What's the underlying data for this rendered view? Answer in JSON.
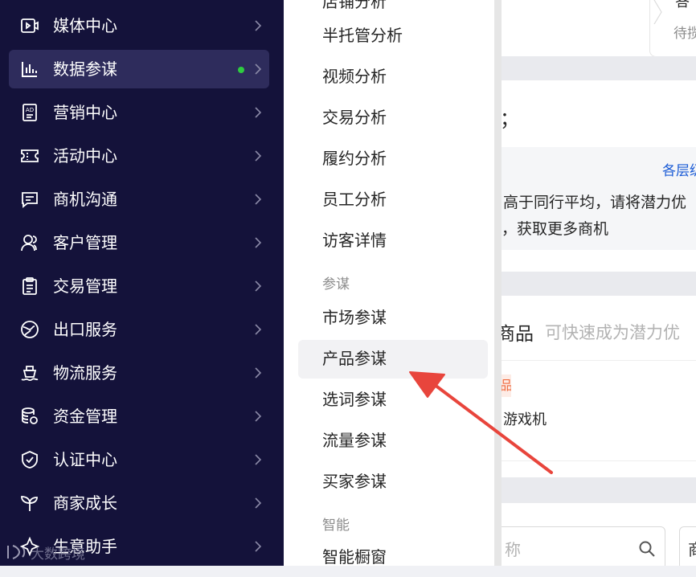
{
  "sidebar": {
    "items": [
      {
        "label": "媒体中心",
        "icon": "media-icon"
      },
      {
        "label": "数据参谋",
        "icon": "bar-chart-icon"
      },
      {
        "label": "营销中心",
        "icon": "ad-icon"
      },
      {
        "label": "活动中心",
        "icon": "ticket-icon"
      },
      {
        "label": "商机沟通",
        "icon": "chat-icon"
      },
      {
        "label": "客户管理",
        "icon": "users-icon"
      },
      {
        "label": "交易管理",
        "icon": "clipboard-icon"
      },
      {
        "label": "出口服务",
        "icon": "globe-icon"
      },
      {
        "label": "物流服务",
        "icon": "shipping-icon"
      },
      {
        "label": "资金管理",
        "icon": "coins-icon"
      },
      {
        "label": "认证中心",
        "icon": "shield-check-icon"
      },
      {
        "label": "商家成长",
        "icon": "sprout-icon"
      },
      {
        "label": "生意助手",
        "icon": "sparkle-icon"
      }
    ],
    "active_index": 1,
    "active_dot_color": "#2ecc40",
    "background_color": "#14123a"
  },
  "watermark": {
    "text": "大数跨境"
  },
  "submenu": {
    "top_partial_label": "店铺分析",
    "items": [
      {
        "label": "半托管分析"
      },
      {
        "label": "视频分析"
      },
      {
        "label": "交易分析"
      },
      {
        "label": "履约分析"
      },
      {
        "label": "员工分析"
      },
      {
        "label": "访客详情"
      }
    ],
    "group_canmou": {
      "title": "参谋",
      "items": [
        {
          "label": "市场参谋"
        },
        {
          "label": "产品参谋"
        },
        {
          "label": "选词参谋"
        },
        {
          "label": "流量参谋"
        },
        {
          "label": "买家参谋"
        }
      ]
    },
    "group_zhineng": {
      "title": "智能",
      "items": [
        {
          "label": "智能橱窗"
        }
      ]
    },
    "highlighted_label": "产品参谋"
  },
  "background": {
    "top_tab_partial": "答",
    "pending_partial": "待揽",
    "section_partial": "；",
    "link_partial": "各层级",
    "notice_line1": "高于同行平均，请将潜力优",
    "notice_line2": "，获取更多商机",
    "product_title_partial": "商品",
    "product_subtitle_partial": "可快速成为潜力优",
    "badge_partial": "品",
    "product_name_partial": "游戏机",
    "search_placeholder_partial": "称",
    "right_input_partial": "商"
  },
  "annotation": {
    "arrow_color": "#e8453c"
  }
}
